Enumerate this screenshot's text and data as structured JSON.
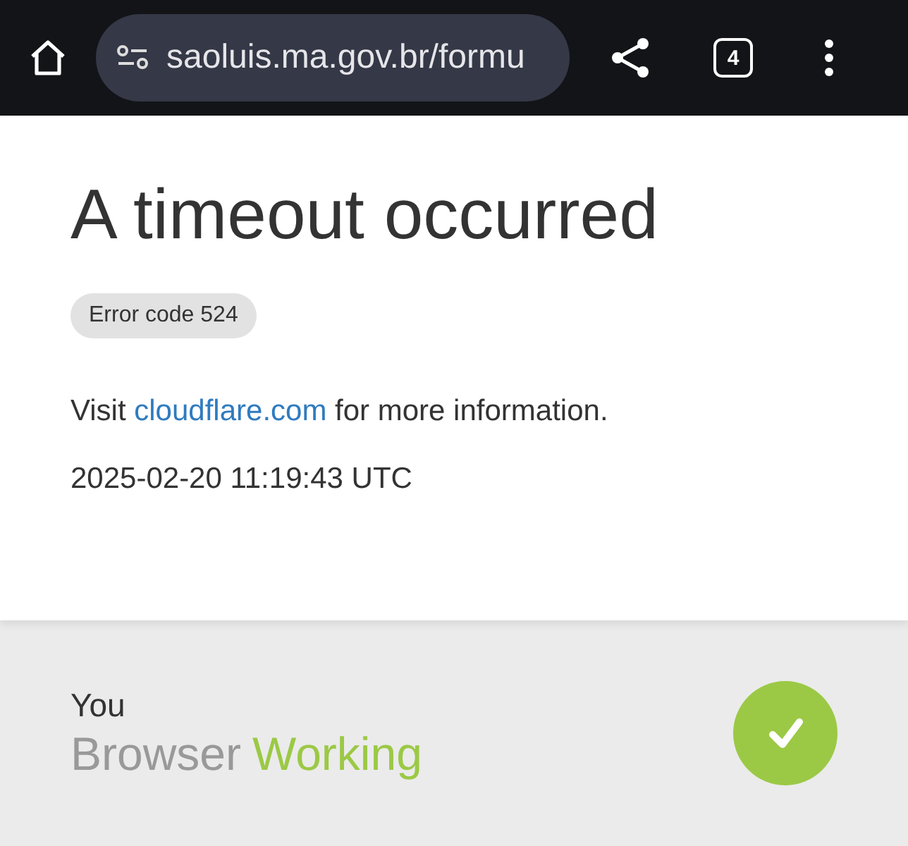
{
  "browser_bar": {
    "url": "saoluis.ma.gov.br/formu",
    "tab_count": "4"
  },
  "error": {
    "title": "A timeout occurred",
    "code": "Error code 524",
    "info": {
      "before": "Visit",
      "link": "cloudflare.com",
      "after": "for more information."
    },
    "timestamp": "2025-02-20 11:19:43 UTC"
  },
  "status": {
    "who": "You",
    "name": "Browser",
    "state": "Working",
    "ok": true
  }
}
